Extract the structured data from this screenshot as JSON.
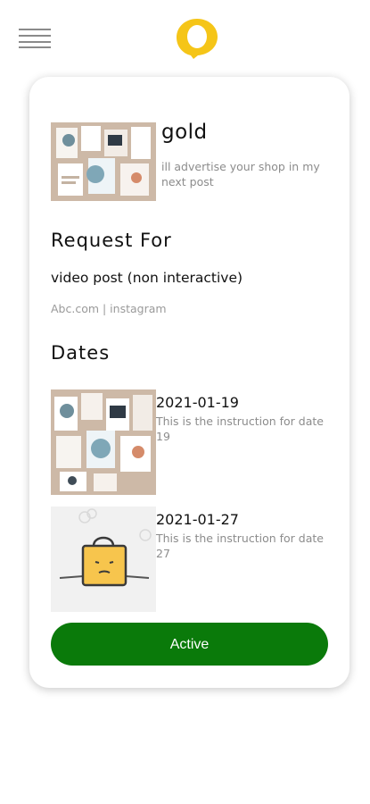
{
  "header": {
    "menu_icon": "hamburger-menu-icon",
    "logo_icon": "yellow-speech-bubble-logo",
    "logo_color": "#F5C518"
  },
  "offer": {
    "title": "gold",
    "description": "ill advertise your shop in my next post"
  },
  "request": {
    "heading": "Request For",
    "type": "video post (non interactive)",
    "target": "Abc.com | instagram"
  },
  "dates": {
    "heading": "Dates",
    "items": [
      {
        "date": "2021-01-19",
        "instruction": "This is the instruction for date 19"
      },
      {
        "date": "2021-01-27",
        "instruction": "This is the instruction for date 27"
      }
    ]
  },
  "status_button": {
    "label": "Active",
    "color": "#0A7A0A"
  }
}
